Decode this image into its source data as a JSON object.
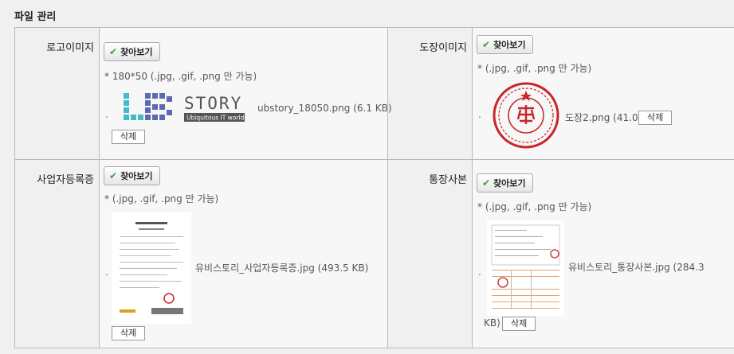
{
  "section": {
    "title": "파일 관리"
  },
  "colors": {
    "seal_red": "#c8262a",
    "logo_blue": "#5b6bb0",
    "check_green": "#3aa13a"
  },
  "cells": {
    "logo": {
      "label": "로고이미지",
      "browse": "찾아보기",
      "hint": "* 180*50 (.jpg, .gif, .png 만 가능)",
      "bullet": ".",
      "file": "ubstory_18050.png (6.1 KB)",
      "delete": "삭제",
      "thumb": {
        "brand": "STORY",
        "tagline": "Ubiquitous IT world",
        "icon": "ub-logo"
      }
    },
    "seal": {
      "label": "도장이미지",
      "browse": "찾아보기",
      "hint": "* (.jpg, .gif, .png 만 가능)",
      "bullet": ".",
      "file": "도장2.png (41.0 KB)",
      "delete": "삭제",
      "thumb": {
        "icon": "company-seal"
      }
    },
    "bizreg": {
      "label": "사업자등록증",
      "browse": "찾아보기",
      "hint": "* (.jpg, .gif, .png 만 가능)",
      "bullet": ".",
      "file": "유비스토리_사업자등록증.jpg (493.5 KB)",
      "delete": "삭제",
      "thumb": {
        "icon": "document-scan"
      }
    },
    "bankbook": {
      "label": "통장사본",
      "browse": "찾아보기",
      "hint": "* (.jpg, .gif, .png 만 가능)",
      "bullet": ".",
      "file_line1": "유비스토리_통장사본.jpg (284.3",
      "file_line2": "KB)",
      "delete": "삭제",
      "thumb": {
        "icon": "bankbook-scan"
      }
    }
  }
}
